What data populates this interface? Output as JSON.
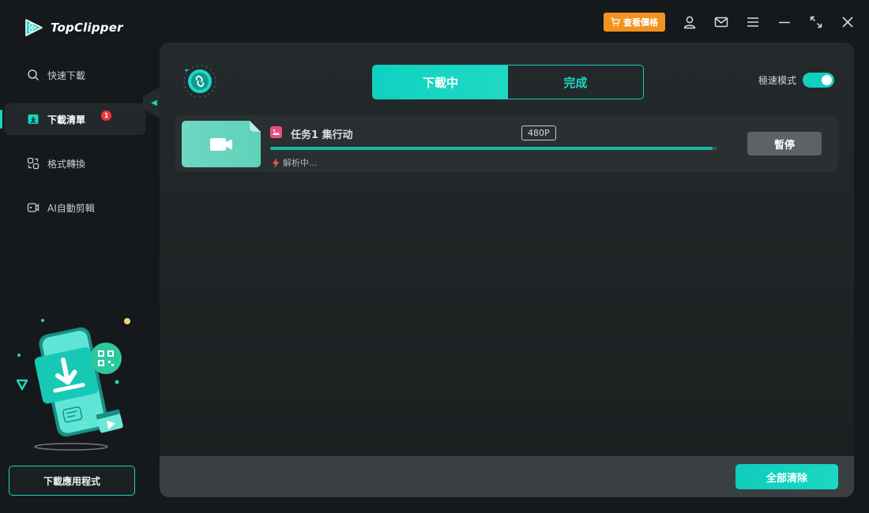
{
  "app": {
    "name": "TopClipper"
  },
  "header": {
    "price_label": "查看價格",
    "icons": [
      "cart-icon",
      "user-icon",
      "mail-icon",
      "menu-icon",
      "minimize-icon",
      "resize-icon",
      "close-icon"
    ]
  },
  "sidebar": {
    "items": [
      {
        "label": "快速下載",
        "icon": "search-icon",
        "active": false
      },
      {
        "label": "下載清單",
        "icon": "download-list-icon",
        "active": true,
        "badge": "1"
      },
      {
        "label": "格式轉換",
        "icon": "convert-icon",
        "active": false
      },
      {
        "label": "AI自動剪輯",
        "icon": "ai-edit-icon",
        "active": false
      }
    ],
    "app_button": "下載應用程式"
  },
  "main": {
    "tabs": [
      {
        "label": "下載中",
        "selected": true
      },
      {
        "label": "完成",
        "selected": false
      }
    ],
    "speed_mode": {
      "label": "極速模式",
      "enabled": true
    },
    "tasks": [
      {
        "title": "任务1 集行动",
        "resolution": "480P",
        "progress": 0.99,
        "status": "解析中...",
        "action": "暫停"
      }
    ],
    "clear_all": "全部清除"
  },
  "colors": {
    "accent": "#17d6c2",
    "background": "#16191b",
    "panel": "#242a2c",
    "price_button": "#f3921e",
    "badge": "#f0353b",
    "task_icon": "#ee4d80"
  }
}
